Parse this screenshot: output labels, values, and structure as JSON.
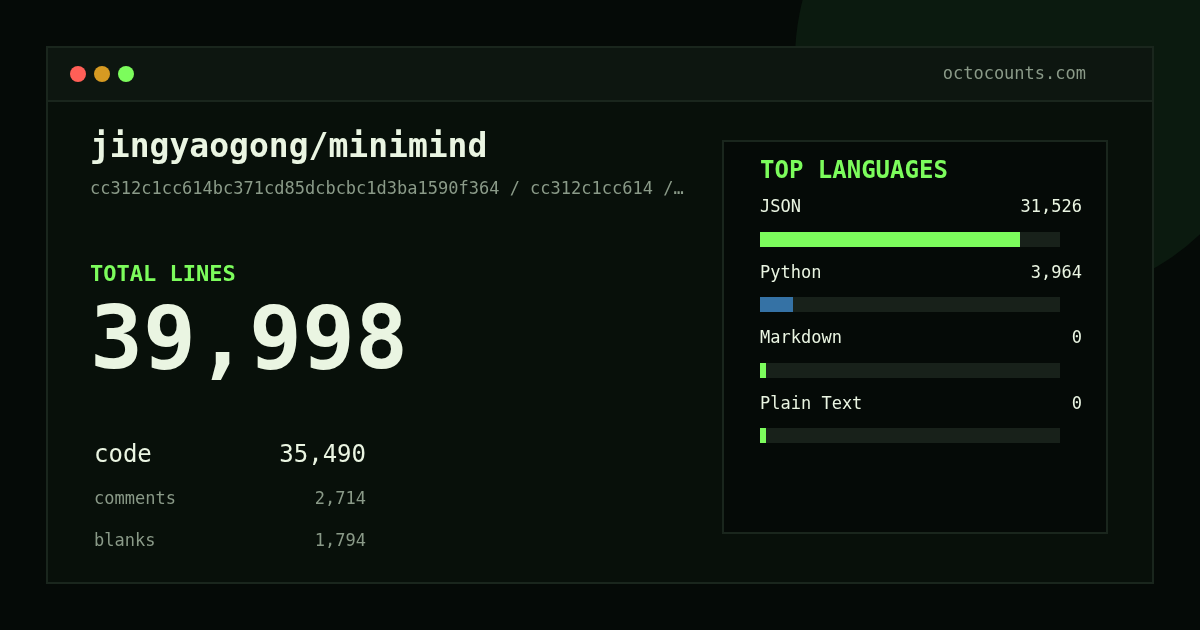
{
  "window": {
    "dots": [
      {
        "color": "#ff5f57"
      },
      {
        "color": "#d69a22"
      },
      {
        "color": "#7cfc5c"
      }
    ],
    "site": "octocounts.com"
  },
  "repo": {
    "name": "jingyaogong/minimind",
    "path": "cc312c1cc614bc371cd85dcbcbc1d3ba1590f364 / cc312c1cc614 /…"
  },
  "total": {
    "label": "TOTAL LINES",
    "value": "39,998"
  },
  "stats": [
    {
      "kind": "primary",
      "label": "code",
      "value": "35,490"
    },
    {
      "kind": "secondary",
      "label": "comments",
      "value": "2,714"
    },
    {
      "kind": "secondary",
      "label": "blanks",
      "value": "1,794"
    }
  ],
  "languages": {
    "title": "TOP LANGUAGES",
    "items": [
      {
        "name": "JSON",
        "value": "31,526",
        "level": 0.867,
        "color": "#7cfc5c"
      },
      {
        "name": "Python",
        "value": "3,964",
        "level": 0.11,
        "color": "#3572a5"
      },
      {
        "name": "Markdown",
        "value": "0",
        "level": 0.02,
        "color": "#7cfc5c"
      },
      {
        "name": "Plain Text",
        "value": "0",
        "level": 0.02,
        "color": "#7cfc5c"
      }
    ]
  }
}
